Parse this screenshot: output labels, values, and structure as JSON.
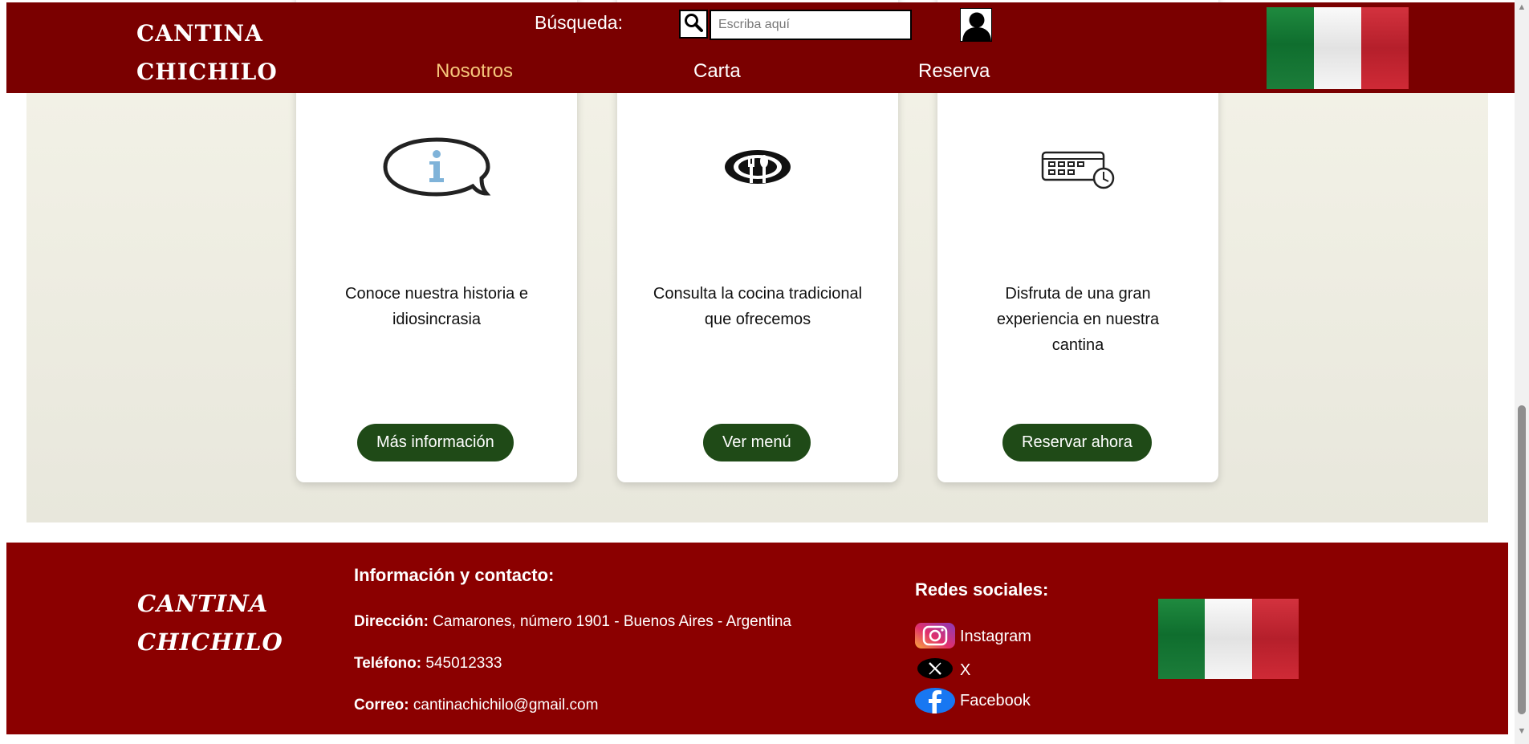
{
  "header": {
    "brand_line1": "CANTINA",
    "brand_line2": "CHICHILO",
    "search_label": "Búsqueda:",
    "search_placeholder": "Escriba aquí",
    "nav": [
      {
        "label": "Nosotros",
        "active": true
      },
      {
        "label": "Carta",
        "active": false
      },
      {
        "label": "Reserva",
        "active": false
      }
    ]
  },
  "cards": [
    {
      "icon": "info-speech-bubble-icon",
      "text": "Conoce nuestra historia e idiosincrasia",
      "button": "Más información"
    },
    {
      "icon": "plate-cutlery-icon",
      "text": "Consulta la cocina tradicional que ofrecemos",
      "button": "Ver menú"
    },
    {
      "icon": "calendar-clock-icon",
      "text": "Disfruta de una gran experiencia en nuestra cantina",
      "button": "Reservar ahora"
    }
  ],
  "footer": {
    "brand_line1": "CANTINA",
    "brand_line2": "CHICHILO",
    "info_heading": "Información y contacto:",
    "address_label": "Dirección:",
    "address_value": "Camarones, número 1901 - Buenos Aires - Argentina",
    "phone_label": "Teléfono:",
    "phone_value": "545012333",
    "email_label": "Correo:",
    "email_value": "cantinachichilo@gmail.com",
    "social_heading": "Redes sociales:",
    "social": [
      {
        "icon": "instagram-icon",
        "label": "Instagram"
      },
      {
        "icon": "x-icon",
        "label": "X"
      },
      {
        "icon": "facebook-icon",
        "label": "Facebook"
      }
    ]
  },
  "colors": {
    "header_bg": "#7a0000",
    "footer_bg": "#8b0000",
    "nav_active": "#f6c77c",
    "button_bg": "#1f4a17"
  }
}
